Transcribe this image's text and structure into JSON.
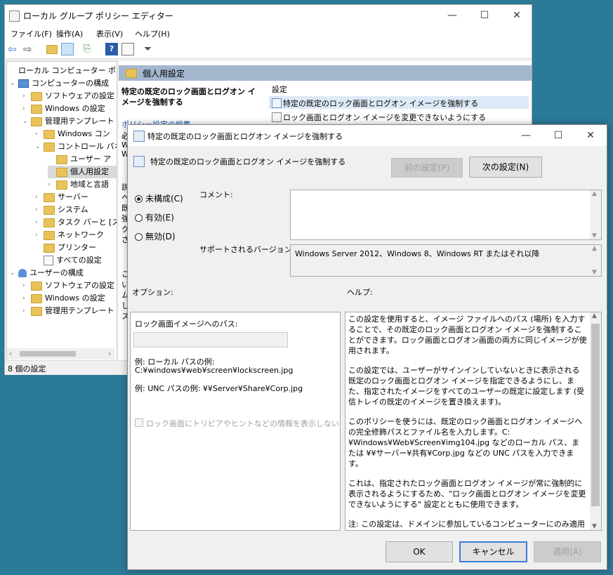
{
  "gpe": {
    "title": "ローカル グループ ポリシー エディター",
    "menu": [
      "ファイル(F)",
      "操作(A)",
      "表示(V)",
      "ヘルプ(H)"
    ],
    "tree": [
      {
        "label": "ローカル コンピューター ポリシ",
        "level": 0
      },
      {
        "label": "コンピューターの構成",
        "level": 1
      },
      {
        "label": "ソフトウェアの設定",
        "level": 2
      },
      {
        "label": "Windows の設定",
        "level": 2
      },
      {
        "label": "管理用テンプレート",
        "level": 2
      },
      {
        "label": "Windows コン",
        "level": 3
      },
      {
        "label": "コントロール パネ",
        "level": 3
      },
      {
        "label": "ユーザー ア",
        "level": 4
      },
      {
        "label": "個人用設定",
        "level": 4
      },
      {
        "label": "地域と言語",
        "level": 4
      },
      {
        "label": "サーバー",
        "level": 3
      },
      {
        "label": "システム",
        "level": 3
      },
      {
        "label": "タスク バーと [ス",
        "level": 3
      },
      {
        "label": "ネットワーク",
        "level": 3
      },
      {
        "label": "プリンター",
        "level": 3
      },
      {
        "label": "すべての設定",
        "level": 3
      },
      {
        "label": "ユーザーの構成",
        "level": 1
      },
      {
        "label": "ソフトウェアの設定",
        "level": 2
      },
      {
        "label": "Windows の設定",
        "level": 2
      },
      {
        "label": "管理用テンプレート",
        "level": 2
      }
    ],
    "pane_header": "個人用設定",
    "desc_title": "特定の既定のロック画面とログオン イメージを強制する",
    "desc_link": "ポリシー設定の編集",
    "desc_fragment": [
      "必",
      "W",
      "W",
      "説",
      "へ",
      "既",
      "強",
      "グ",
      "さ",
      "こ",
      "い",
      "ム",
      "し",
      "ス"
    ],
    "col_header": "設定",
    "settings": [
      "特定の既定のロック画面とログオン イメージを強制する",
      "ロック画面とログオン イメージを変更できないようにする"
    ],
    "status": "8 個の設定"
  },
  "dialog": {
    "title": "特定の既定のロック画面とログオン イメージを強制する",
    "heading": "特定の既定のロック画面とログオン イメージを強制する",
    "prev_button": "前の設定(P)",
    "next_button": "次の設定(N)",
    "radio_not_configured": "未構成(C)",
    "radio_enabled": "有効(E)",
    "radio_disabled": "無効(D)",
    "comment_label": "コメント:",
    "supported_label": "サポートされるバージョン:",
    "supported_value": "Windows Server 2012、Windows 8、Windows RT またはそれ以降",
    "options_label": "オプション:",
    "help_label": "ヘルプ:",
    "path_label": "ロック画面イメージへのパス:",
    "example_local_1": "例: ローカル パスの例:",
    "example_local_2": "C:¥windows¥web¥screen¥lockscreen.jpg",
    "example_unc": "例: UNC パスの例: ¥¥Server¥Share¥Corp.jpg",
    "checkbox_label": "ロック画面にトリビアやヒントなどの情報を表示しない",
    "help_paragraphs": [
      "この設定を使用すると、イメージ ファイルへのパス (場所) を入力することで、その既定のロック画面とログオン イメージを強制することができます。ロック画面とログオン画面の両方に同じイメージが使用されます。",
      "この設定では、ユーザーがサインインしていないときに表示される既定のロック画面とログオン イメージを指定できるようにし、また、指定されたイメージをすべてのユーザーの既定に設定します (受信トレイの既定のイメージを置き換えます)。",
      "このポリシーを使うには、既定のロック画面とログオン イメージへの完全修飾パスとファイル名を入力します。C:¥Windows¥Web¥Screen¥img104.jpg などのローカル パス、または ¥¥サーバー¥共有¥Corp.jpg などの UNC パスを入力できます。",
      "これは、指定されたロック画面とログオン イメージが常に強制的に表示されるようにするため、\"ロック画面とログオン イメージを変更できないようにする\" 設定とともに使用できます。",
      "注: この設定は、ドメインに参加しているコンピューターにのみ適用され、Enterprise SKU、Education SKU、および Server SKU では無条件に適用されます。"
    ],
    "ok_button": "OK",
    "cancel_button": "キャンセル",
    "apply_button": "適用(A)"
  }
}
